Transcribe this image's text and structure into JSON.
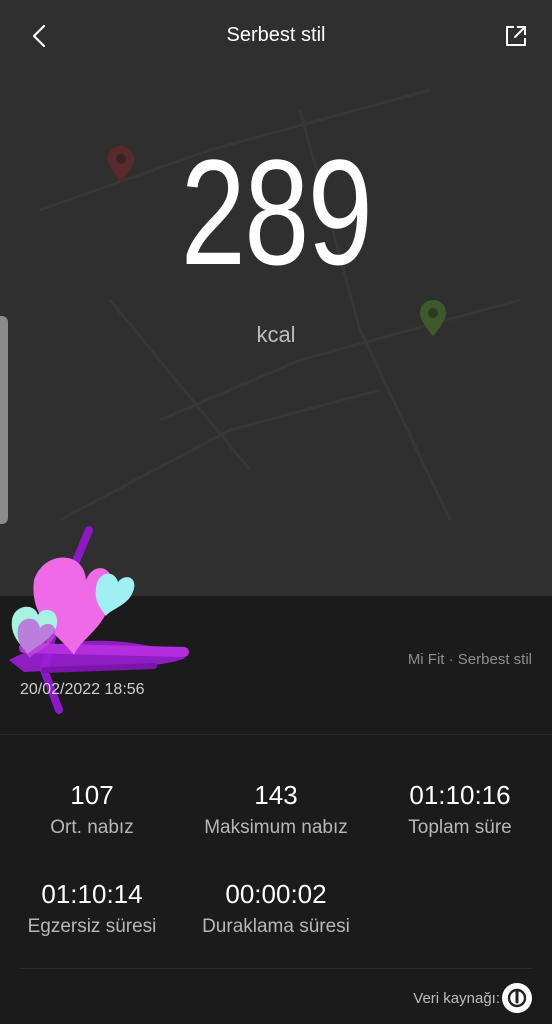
{
  "header": {
    "title": "Serbest stil",
    "back_icon": "back-arrow-icon",
    "share_icon": "share-external-icon"
  },
  "summary": {
    "value": "289",
    "unit": "kcal"
  },
  "meta": {
    "source": "Mi Fit · Serbest stil",
    "datetime": "20/02/2022 18:56"
  },
  "stats": [
    {
      "value": "107",
      "label": "Ort. nabız"
    },
    {
      "value": "143",
      "label": "Maksimum nabız"
    },
    {
      "value": "01:10:16",
      "label": "Toplam süre"
    },
    {
      "value": "01:10:14",
      "label": "Egzersiz süresi"
    },
    {
      "value": "00:00:02",
      "label": "Duraklama süresi"
    }
  ],
  "footer": {
    "data_source_label": "Veri kaynağı:",
    "logo_icon": "mi-fit-logo-icon"
  },
  "colors": {
    "hero_bg": "#2f2f2f",
    "page_bg": "#1b1b1b",
    "sticker_pink": "#f06ae8",
    "sticker_purple": "#9b1fd6",
    "sticker_cyan": "#9ff0f2"
  }
}
